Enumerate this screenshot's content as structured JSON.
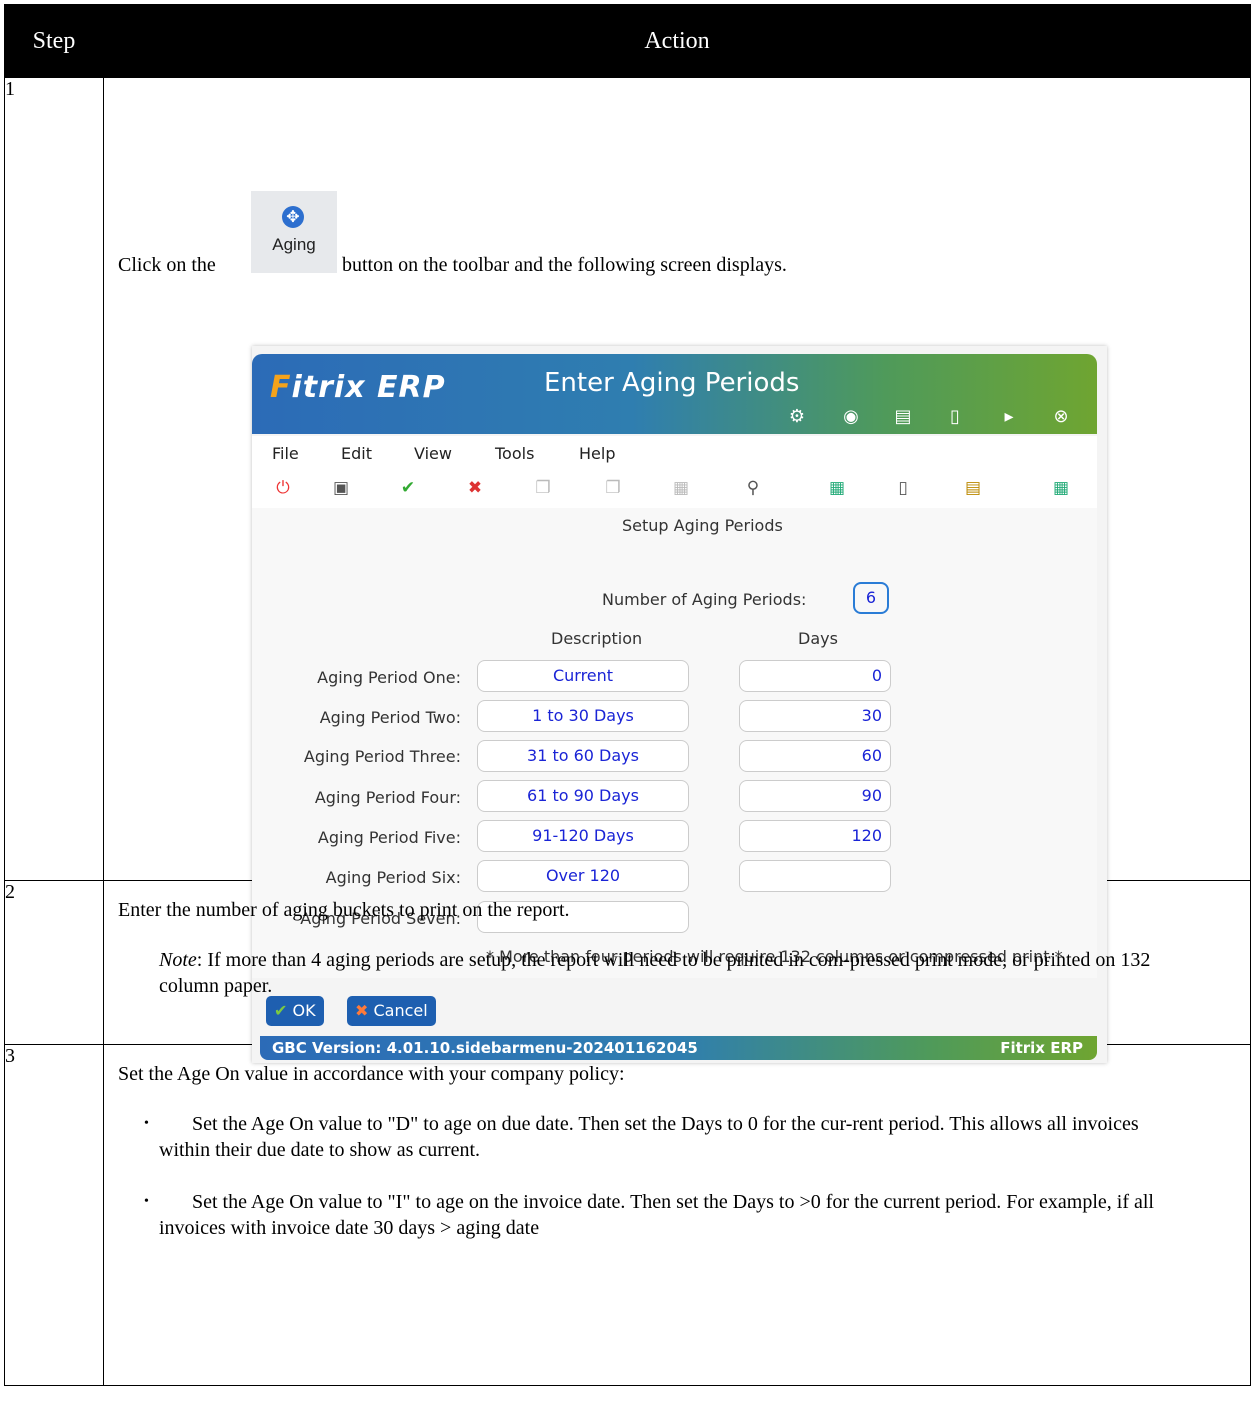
{
  "header": {
    "step": "Step",
    "action": "Action"
  },
  "rows": [
    {
      "step": "1",
      "line_pre": "Click on the",
      "aging_button_label": "Aging",
      "line_post": "button on the toolbar and the following screen displays."
    },
    {
      "step": "2",
      "main": "Enter the number of aging buckets to print on the report.",
      "note_label": "Note",
      "note_text": ": If more than 4 aging periods are setup, the report will need to be printed in com-pressed print mode, or printed on 132 column paper."
    },
    {
      "step": "3",
      "main": "Set the Age On value in accordance with your company policy:",
      "bullets": [
        "Set the Age On value to \"D\" to age on due date. Then set the Days to 0 for the cur-rent period. This allows all invoices within their due date to show as current.",
        "Set the Age On value to \"I\" to age on the invoice date. Then set the Days to >0 for the current period. For example, if all invoices with invoice date 30 days > aging date"
      ]
    }
  ],
  "window": {
    "logo": "Fitrix ERP",
    "title": "Enter Aging Periods",
    "menu": [
      "File",
      "Edit",
      "View",
      "Tools",
      "Help"
    ],
    "form_title": "Setup Aging Periods",
    "num_label": "Number of Aging Periods:",
    "num_value": "6",
    "col_desc": "Description",
    "col_days": "Days",
    "periods": [
      {
        "label": "Aging Period One:",
        "desc": "Current",
        "days": "0"
      },
      {
        "label": "Aging Period Two:",
        "desc": "1 to 30 Days",
        "days": "30"
      },
      {
        "label": "Aging Period Three:",
        "desc": "31 to 60 Days",
        "days": "60"
      },
      {
        "label": "Aging Period Four:",
        "desc": "61 to 90 Days",
        "days": "90"
      },
      {
        "label": "Aging Period Five:",
        "desc": "91-120 Days",
        "days": "120"
      },
      {
        "label": "Aging Period Six:",
        "desc": "Over 120",
        "days": ""
      },
      {
        "label": "Aging Period Seven:",
        "desc": "",
        "days": null
      }
    ],
    "footnote": "* More than four periods will require 132 columns or compressed print *",
    "ok_label": "OK",
    "cancel_label": "Cancel",
    "version": "GBC Version: 4.01.10.sidebarmenu-202401162045",
    "brand": "Fitrix ERP"
  }
}
